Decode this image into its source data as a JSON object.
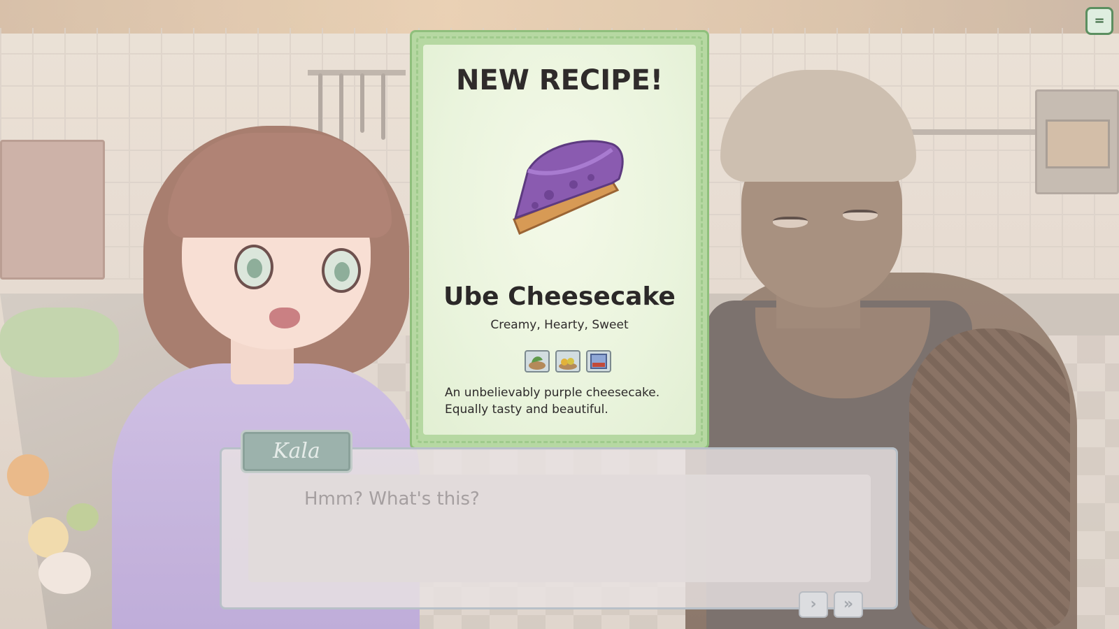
{
  "recipe_card": {
    "title": "NEW RECIPE!",
    "dish_name": "Ube Cheesecake",
    "tags": "Creamy, Hearty, Sweet",
    "description": "An unbelievably purple cheesecake. Equally tasty and beautiful.",
    "ingredients": [
      {
        "icon": "herb-bowl-icon"
      },
      {
        "icon": "fruit-bowl-icon"
      },
      {
        "icon": "preserves-jar-icon"
      }
    ],
    "colors": {
      "card_border": "#b6d8a2",
      "cake_top": "#8a5bb0",
      "crust": "#d79a55"
    }
  },
  "dialogue": {
    "speaker": "Kala",
    "text": "Hmm?  What's this?",
    "next_label": "›",
    "skip_label": "»"
  },
  "menu": {
    "icon": "menu-icon",
    "label": "="
  }
}
